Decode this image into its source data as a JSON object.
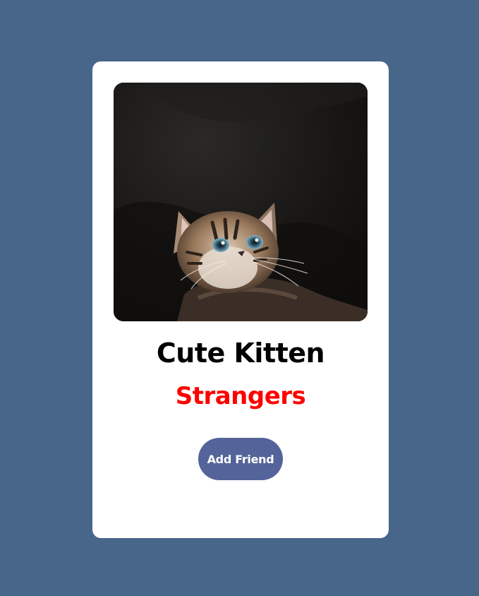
{
  "card": {
    "photo": {
      "subject": "kitten",
      "alt": "kitten-photo"
    },
    "name": "Cute Kitten",
    "status": "Strangers",
    "button_label": "Add Friend"
  },
  "colors": {
    "background": "#48658a",
    "card": "#ffffff",
    "status": "#ff0000",
    "button": "#546399",
    "name": "#000000"
  }
}
